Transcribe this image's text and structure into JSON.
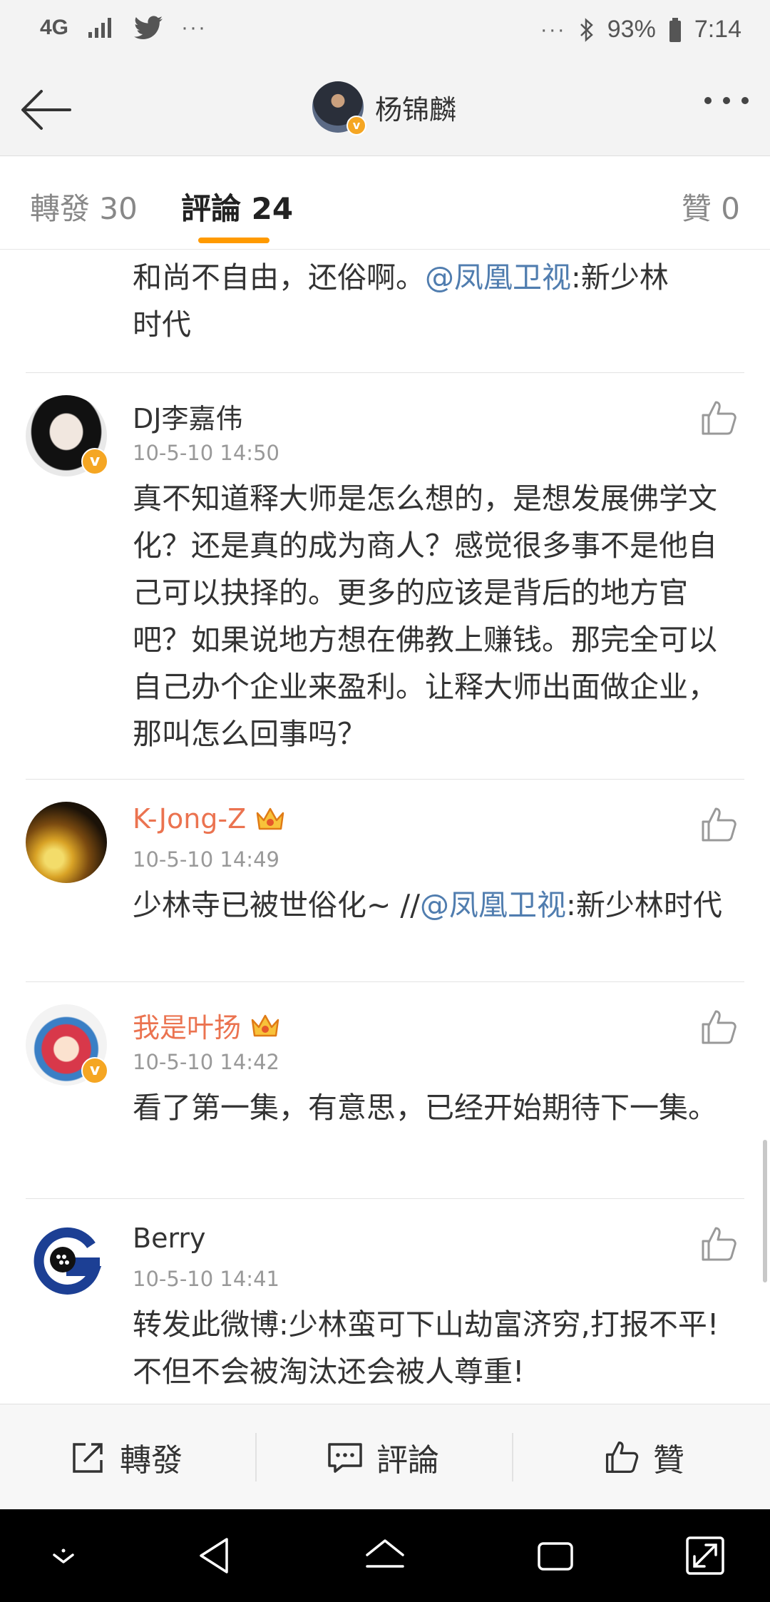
{
  "status_bar": {
    "network": "4G",
    "overflow": "···",
    "battery": "93%",
    "time": "7:14"
  },
  "header": {
    "title": "杨锦麟"
  },
  "tabs": {
    "repost": "轉發 30",
    "comments": "評論 24",
    "likes": "贊 0"
  },
  "top_partial": {
    "text_a": "和尚不自由，还俗啊。",
    "mention": "@凤凰卫视",
    "text_b": ":新少林",
    "line2": "时代"
  },
  "comments": [
    {
      "name": "DJ李嘉伟",
      "time": "10-5-10 14:50",
      "text": "真不知道释大师是怎么想的，是想发展佛学文化？还是真的成为商人？感觉很多事不是他自己可以抉择的。更多的应该是背后的地方官吧？如果说地方想在佛教上赚钱。那完全可以自己办个企业来盈利。让释大师出面做企业，那叫怎么回事吗？"
    },
    {
      "name": "K-Jong-Z",
      "time": "10-5-10 14:49",
      "text_a": "少林寺已被世俗化~ //",
      "mention": "@凤凰卫视",
      "text_b": ":新少林时代"
    },
    {
      "name": "我是叶扬",
      "time": "10-5-10 14:42",
      "text": "看了第一集，有意思，已经开始期待下一集。"
    },
    {
      "name": "Berry",
      "time": "10-5-10 14:41",
      "text": "转发此微博:少林蛮可下山劫富济穷,打报不平!不但不会被淘汰还会被人尊重!"
    }
  ],
  "action_bar": {
    "repost": "轉發",
    "comment": "評論",
    "like": "贊"
  },
  "colors": {
    "accent": "#ff9a00",
    "mention": "#507daf",
    "vip_name": "#eb7350",
    "verified": "#f5a623"
  }
}
